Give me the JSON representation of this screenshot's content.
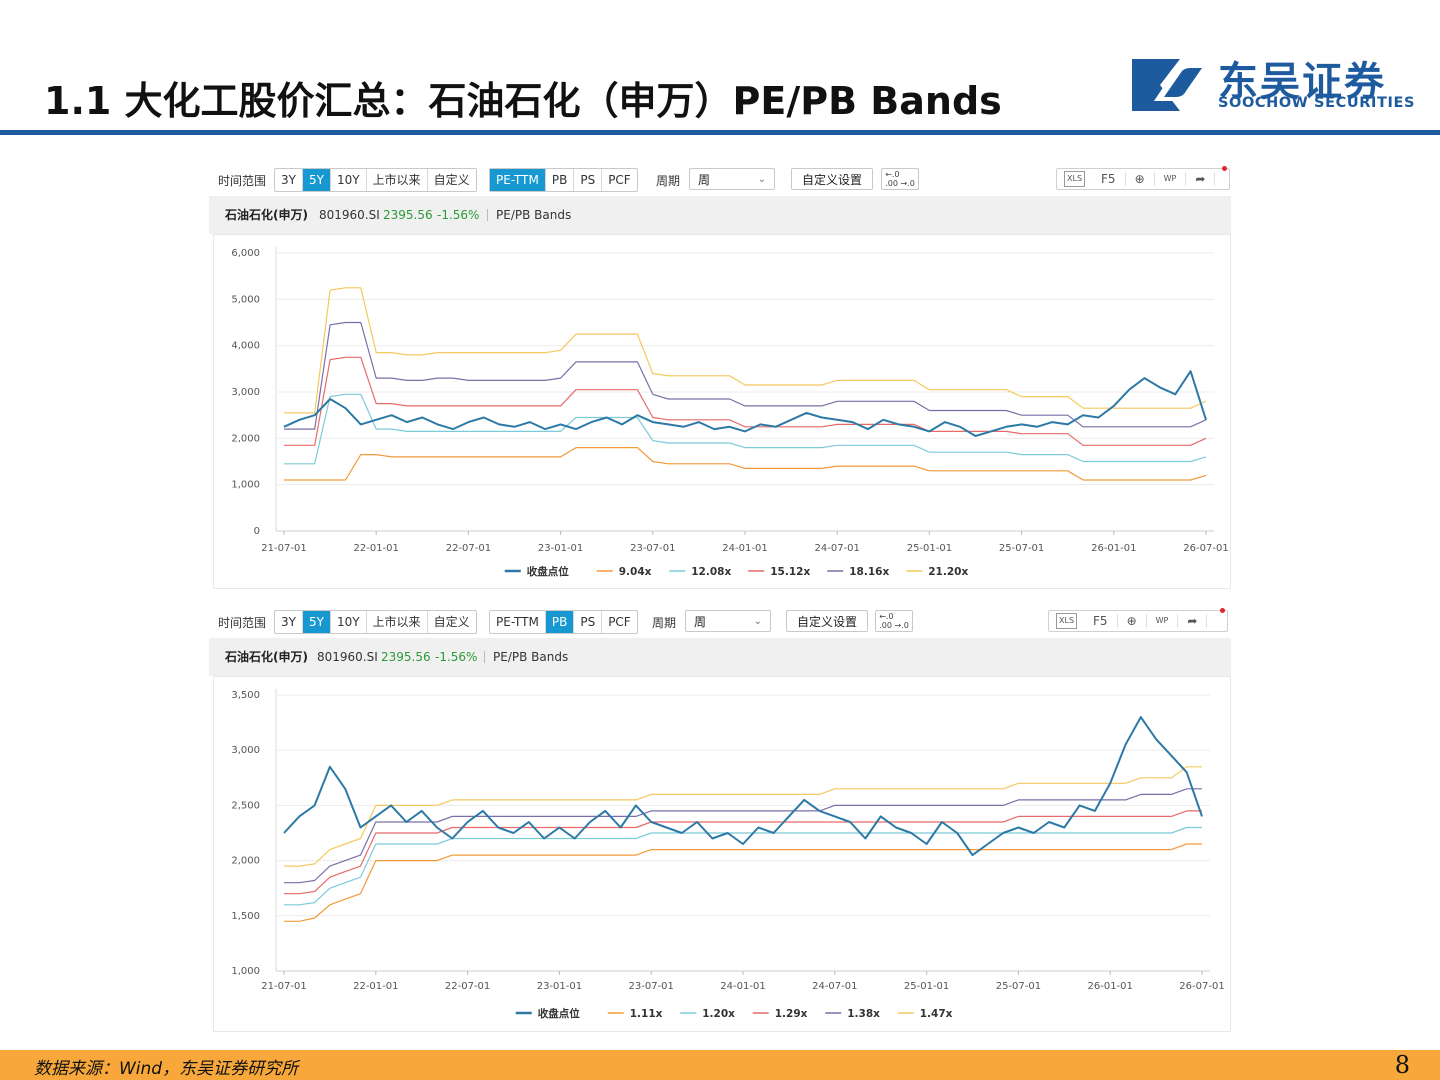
{
  "slide": {
    "title": "1.1 大化工股价汇总：石油石化（申万）PE/PB Bands",
    "logo_cn": "东吴证券",
    "logo_en": "SOOCHOW SECURITIES",
    "source": "数据来源：Wind，东吴证券研究所",
    "page_number": "8"
  },
  "colors": {
    "brand_blue": "#1d5a9e",
    "footer_orange": "#f8a83b",
    "active_tab": "#1798d0",
    "close_line": "#2c79a6",
    "band_1": "#f29a3a",
    "band_2": "#7ccbd8",
    "band_3": "#e86a6a",
    "band_4": "#7a6fa8",
    "band_5": "#f5c860"
  },
  "panels": [
    {
      "toolbar": {
        "range_label": "时间范围",
        "ranges": [
          "3Y",
          "5Y",
          "10Y",
          "上市以来",
          "自定义"
        ],
        "active_range": "5Y",
        "metrics": [
          "PE-TTM",
          "PB",
          "PS",
          "PCF"
        ],
        "active_metric": "PE-TTM",
        "period_label": "周期",
        "period_value": "周",
        "custom_settings": "自定义设置",
        "tool_xls": "XLS",
        "tool_f5": "F5",
        "tool_wp": "WP"
      },
      "info": {
        "name": "石油石化(申万)",
        "code": "801960.SI",
        "price": "2395.56",
        "change": "-1.56%",
        "type": "PE/PB Bands"
      }
    },
    {
      "toolbar": {
        "range_label": "时间范围",
        "ranges": [
          "3Y",
          "5Y",
          "10Y",
          "上市以来",
          "自定义"
        ],
        "active_range": "5Y",
        "metrics": [
          "PE-TTM",
          "PB",
          "PS",
          "PCF"
        ],
        "active_metric": "PB",
        "period_label": "周期",
        "period_value": "周",
        "custom_settings": "自定义设置",
        "tool_xls": "XLS",
        "tool_f5": "F5",
        "tool_wp": "WP"
      },
      "info": {
        "name": "石油石化(申万)",
        "code": "801960.SI",
        "price": "2395.56",
        "change": "-1.56%",
        "type": "PE/PB Bands"
      }
    }
  ],
  "chart_data": [
    {
      "type": "line",
      "x_ticks": [
        "21-07-01",
        "22-01-01",
        "22-07-01",
        "23-01-01",
        "23-07-01",
        "24-01-01",
        "24-07-01",
        "25-01-01",
        "25-07-01",
        "26-01-01",
        "26-07-01"
      ],
      "y_ticks": [
        "0",
        "1,000",
        "2,000",
        "3,000",
        "4,000",
        "5,000",
        "6,000"
      ],
      "ylim": [
        0,
        6000
      ],
      "grid": "horizontal",
      "legend_position": "bottom",
      "x_time": [
        "2021-07",
        "2021-08",
        "2021-09",
        "2021-10",
        "2021-11",
        "2021-12",
        "2022-01",
        "2022-02",
        "2022-03",
        "2022-04",
        "2022-05",
        "2022-06",
        "2022-07",
        "2022-08",
        "2022-09",
        "2022-10",
        "2022-11",
        "2022-12",
        "2023-01",
        "2023-02",
        "2023-03",
        "2023-04",
        "2023-05",
        "2023-06",
        "2023-07",
        "2023-08",
        "2023-09",
        "2023-10",
        "2023-11",
        "2023-12",
        "2024-01",
        "2024-02",
        "2024-03",
        "2024-04",
        "2024-05",
        "2024-06",
        "2024-07",
        "2024-08",
        "2024-09",
        "2024-10",
        "2024-11",
        "2024-12",
        "2025-01",
        "2025-02",
        "2025-03",
        "2025-04",
        "2025-05",
        "2025-06",
        "2025-07",
        "2025-08",
        "2025-09",
        "2025-10",
        "2025-11",
        "2025-12",
        "2026-01",
        "2026-02",
        "2026-03",
        "2026-04",
        "2026-05",
        "2026-06",
        "2026-07"
      ],
      "series": [
        {
          "name": "收盘点位",
          "color": "#2c79a6",
          "values": [
            2250,
            2400,
            2500,
            2850,
            2650,
            2300,
            2400,
            2500,
            2350,
            2450,
            2300,
            2200,
            2350,
            2450,
            2300,
            2250,
            2350,
            2200,
            2300,
            2200,
            2350,
            2450,
            2300,
            2500,
            2350,
            2300,
            2250,
            2350,
            2200,
            2250,
            2150,
            2300,
            2250,
            2400,
            2550,
            2450,
            2400,
            2350,
            2200,
            2400,
            2300,
            2250,
            2150,
            2350,
            2250,
            2050,
            2150,
            2250,
            2300,
            2250,
            2350,
            2300,
            2500,
            2450,
            2700,
            3050,
            3300,
            3100,
            2950,
            3450,
            2400
          ]
        },
        {
          "name": "9.04x",
          "color": "#f29a3a",
          "values": [
            1100,
            1100,
            1100,
            1100,
            1100,
            1650,
            1650,
            1600,
            1600,
            1600,
            1600,
            1600,
            1600,
            1600,
            1600,
            1600,
            1600,
            1600,
            1600,
            1800,
            1800,
            1800,
            1800,
            1800,
            1500,
            1450,
            1450,
            1450,
            1450,
            1450,
            1350,
            1350,
            1350,
            1350,
            1350,
            1350,
            1400,
            1400,
            1400,
            1400,
            1400,
            1400,
            1300,
            1300,
            1300,
            1300,
            1300,
            1300,
            1300,
            1300,
            1300,
            1300,
            1100,
            1100,
            1100,
            1100,
            1100,
            1100,
            1100,
            1100,
            1200
          ]
        },
        {
          "name": "12.08x",
          "color": "#7ccbd8",
          "values": [
            1450,
            1450,
            1450,
            2900,
            2950,
            2950,
            2200,
            2200,
            2150,
            2150,
            2150,
            2150,
            2150,
            2150,
            2150,
            2150,
            2150,
            2150,
            2150,
            2450,
            2450,
            2450,
            2450,
            2450,
            1950,
            1900,
            1900,
            1900,
            1900,
            1900,
            1800,
            1800,
            1800,
            1800,
            1800,
            1800,
            1850,
            1850,
            1850,
            1850,
            1850,
            1850,
            1700,
            1700,
            1700,
            1700,
            1700,
            1700,
            1650,
            1650,
            1650,
            1650,
            1500,
            1500,
            1500,
            1500,
            1500,
            1500,
            1500,
            1500,
            1600
          ]
        },
        {
          "name": "15.12x",
          "color": "#e86a6a",
          "values": [
            1850,
            1850,
            1850,
            3700,
            3750,
            3750,
            2750,
            2750,
            2700,
            2700,
            2700,
            2700,
            2700,
            2700,
            2700,
            2700,
            2700,
            2700,
            2700,
            3050,
            3050,
            3050,
            3050,
            3050,
            2450,
            2400,
            2400,
            2400,
            2400,
            2400,
            2250,
            2250,
            2250,
            2250,
            2250,
            2250,
            2300,
            2300,
            2300,
            2300,
            2300,
            2300,
            2150,
            2150,
            2150,
            2150,
            2150,
            2150,
            2100,
            2100,
            2100,
            2100,
            1850,
            1850,
            1850,
            1850,
            1850,
            1850,
            1850,
            1850,
            2000
          ]
        },
        {
          "name": "18.16x",
          "color": "#7a6fa8",
          "values": [
            2200,
            2200,
            2200,
            4450,
            4500,
            4500,
            3300,
            3300,
            3250,
            3250,
            3300,
            3300,
            3250,
            3250,
            3250,
            3250,
            3250,
            3250,
            3300,
            3650,
            3650,
            3650,
            3650,
            3650,
            2950,
            2850,
            2850,
            2850,
            2850,
            2850,
            2700,
            2700,
            2700,
            2700,
            2700,
            2700,
            2800,
            2800,
            2800,
            2800,
            2800,
            2800,
            2600,
            2600,
            2600,
            2600,
            2600,
            2600,
            2500,
            2500,
            2500,
            2500,
            2250,
            2250,
            2250,
            2250,
            2250,
            2250,
            2250,
            2250,
            2400
          ]
        },
        {
          "name": "21.20x",
          "color": "#f5c860",
          "values": [
            2550,
            2550,
            2550,
            5200,
            5250,
            5250,
            3850,
            3850,
            3800,
            3800,
            3850,
            3850,
            3850,
            3850,
            3850,
            3850,
            3850,
            3850,
            3900,
            4250,
            4250,
            4250,
            4250,
            4250,
            3400,
            3350,
            3350,
            3350,
            3350,
            3350,
            3150,
            3150,
            3150,
            3150,
            3150,
            3150,
            3250,
            3250,
            3250,
            3250,
            3250,
            3250,
            3050,
            3050,
            3050,
            3050,
            3050,
            3050,
            2900,
            2900,
            2900,
            2900,
            2650,
            2650,
            2650,
            2650,
            2650,
            2650,
            2650,
            2650,
            2800
          ]
        }
      ]
    },
    {
      "type": "line",
      "x_ticks": [
        "21-07-01",
        "22-01-01",
        "22-07-01",
        "23-01-01",
        "23-07-01",
        "24-01-01",
        "24-07-01",
        "25-01-01",
        "25-07-01",
        "26-01-01",
        "26-07-01"
      ],
      "y_ticks": [
        "1,000",
        "1,500",
        "2,000",
        "2,500",
        "3,000",
        "3,500"
      ],
      "ylim": [
        1000,
        3500
      ],
      "grid": "horizontal",
      "legend_position": "bottom",
      "x_time": [
        "2021-07",
        "2021-08",
        "2021-09",
        "2021-10",
        "2021-11",
        "2021-12",
        "2022-01",
        "2022-02",
        "2022-03",
        "2022-04",
        "2022-05",
        "2022-06",
        "2022-07",
        "2022-08",
        "2022-09",
        "2022-10",
        "2022-11",
        "2022-12",
        "2023-01",
        "2023-02",
        "2023-03",
        "2023-04",
        "2023-05",
        "2023-06",
        "2023-07",
        "2023-08",
        "2023-09",
        "2023-10",
        "2023-11",
        "2023-12",
        "2024-01",
        "2024-02",
        "2024-03",
        "2024-04",
        "2024-05",
        "2024-06",
        "2024-07",
        "2024-08",
        "2024-09",
        "2024-10",
        "2024-11",
        "2024-12",
        "2025-01",
        "2025-02",
        "2025-03",
        "2025-04",
        "2025-05",
        "2025-06",
        "2025-07",
        "2025-08",
        "2025-09",
        "2025-10",
        "2025-11",
        "2025-12",
        "2026-01",
        "2026-02",
        "2026-03",
        "2026-04",
        "2026-05",
        "2026-06",
        "2026-07"
      ],
      "series": [
        {
          "name": "收盘点位",
          "color": "#2c79a6",
          "values": [
            2250,
            2400,
            2500,
            2850,
            2650,
            2300,
            2400,
            2500,
            2350,
            2450,
            2300,
            2200,
            2350,
            2450,
            2300,
            2250,
            2350,
            2200,
            2300,
            2200,
            2350,
            2450,
            2300,
            2500,
            2350,
            2300,
            2250,
            2350,
            2200,
            2250,
            2150,
            2300,
            2250,
            2400,
            2550,
            2450,
            2400,
            2350,
            2200,
            2400,
            2300,
            2250,
            2150,
            2350,
            2250,
            2050,
            2150,
            2250,
            2300,
            2250,
            2350,
            2300,
            2500,
            2450,
            2700,
            3050,
            3300,
            3100,
            2950,
            2800,
            2400
          ]
        },
        {
          "name": "1.11x",
          "color": "#f29a3a",
          "values": [
            1450,
            1450,
            1480,
            1600,
            1650,
            1700,
            2000,
            2000,
            2000,
            2000,
            2000,
            2050,
            2050,
            2050,
            2050,
            2050,
            2050,
            2050,
            2050,
            2050,
            2050,
            2050,
            2050,
            2050,
            2100,
            2100,
            2100,
            2100,
            2100,
            2100,
            2100,
            2100,
            2100,
            2100,
            2100,
            2100,
            2100,
            2100,
            2100,
            2100,
            2100,
            2100,
            2100,
            2100,
            2100,
            2100,
            2100,
            2100,
            2100,
            2100,
            2100,
            2100,
            2100,
            2100,
            2100,
            2100,
            2100,
            2100,
            2100,
            2150,
            2150
          ]
        },
        {
          "name": "1.20x",
          "color": "#7ccbd8",
          "values": [
            1600,
            1600,
            1620,
            1750,
            1800,
            1850,
            2150,
            2150,
            2150,
            2150,
            2150,
            2200,
            2200,
            2200,
            2200,
            2200,
            2200,
            2200,
            2200,
            2200,
            2200,
            2200,
            2200,
            2200,
            2250,
            2250,
            2250,
            2250,
            2250,
            2250,
            2250,
            2250,
            2250,
            2250,
            2250,
            2250,
            2250,
            2250,
            2250,
            2250,
            2250,
            2250,
            2250,
            2250,
            2250,
            2250,
            2250,
            2250,
            2250,
            2250,
            2250,
            2250,
            2250,
            2250,
            2250,
            2250,
            2250,
            2250,
            2250,
            2300,
            2300
          ]
        },
        {
          "name": "1.29x",
          "color": "#e86a6a",
          "values": [
            1700,
            1700,
            1720,
            1850,
            1900,
            1950,
            2250,
            2250,
            2250,
            2250,
            2250,
            2300,
            2300,
            2300,
            2300,
            2300,
            2300,
            2300,
            2300,
            2300,
            2300,
            2300,
            2300,
            2300,
            2350,
            2350,
            2350,
            2350,
            2350,
            2350,
            2350,
            2350,
            2350,
            2350,
            2350,
            2350,
            2350,
            2350,
            2350,
            2350,
            2350,
            2350,
            2350,
            2350,
            2350,
            2350,
            2350,
            2350,
            2400,
            2400,
            2400,
            2400,
            2400,
            2400,
            2400,
            2400,
            2400,
            2400,
            2400,
            2450,
            2450
          ]
        },
        {
          "name": "1.38x",
          "color": "#7a6fa8",
          "values": [
            1800,
            1800,
            1820,
            1950,
            2000,
            2050,
            2350,
            2350,
            2350,
            2350,
            2350,
            2400,
            2400,
            2400,
            2400,
            2400,
            2400,
            2400,
            2400,
            2400,
            2400,
            2400,
            2400,
            2400,
            2450,
            2450,
            2450,
            2450,
            2450,
            2450,
            2450,
            2450,
            2450,
            2450,
            2450,
            2450,
            2500,
            2500,
            2500,
            2500,
            2500,
            2500,
            2500,
            2500,
            2500,
            2500,
            2500,
            2500,
            2550,
            2550,
            2550,
            2550,
            2550,
            2550,
            2550,
            2550,
            2600,
            2600,
            2600,
            2650,
            2650
          ]
        },
        {
          "name": "1.47x",
          "color": "#f5c860",
          "values": [
            1950,
            1950,
            1970,
            2100,
            2150,
            2200,
            2500,
            2500,
            2500,
            2500,
            2500,
            2550,
            2550,
            2550,
            2550,
            2550,
            2550,
            2550,
            2550,
            2550,
            2550,
            2550,
            2550,
            2550,
            2600,
            2600,
            2600,
            2600,
            2600,
            2600,
            2600,
            2600,
            2600,
            2600,
            2600,
            2600,
            2650,
            2650,
            2650,
            2650,
            2650,
            2650,
            2650,
            2650,
            2650,
            2650,
            2650,
            2650,
            2700,
            2700,
            2700,
            2700,
            2700,
            2700,
            2700,
            2700,
            2750,
            2750,
            2750,
            2850,
            2850
          ]
        }
      ]
    }
  ]
}
